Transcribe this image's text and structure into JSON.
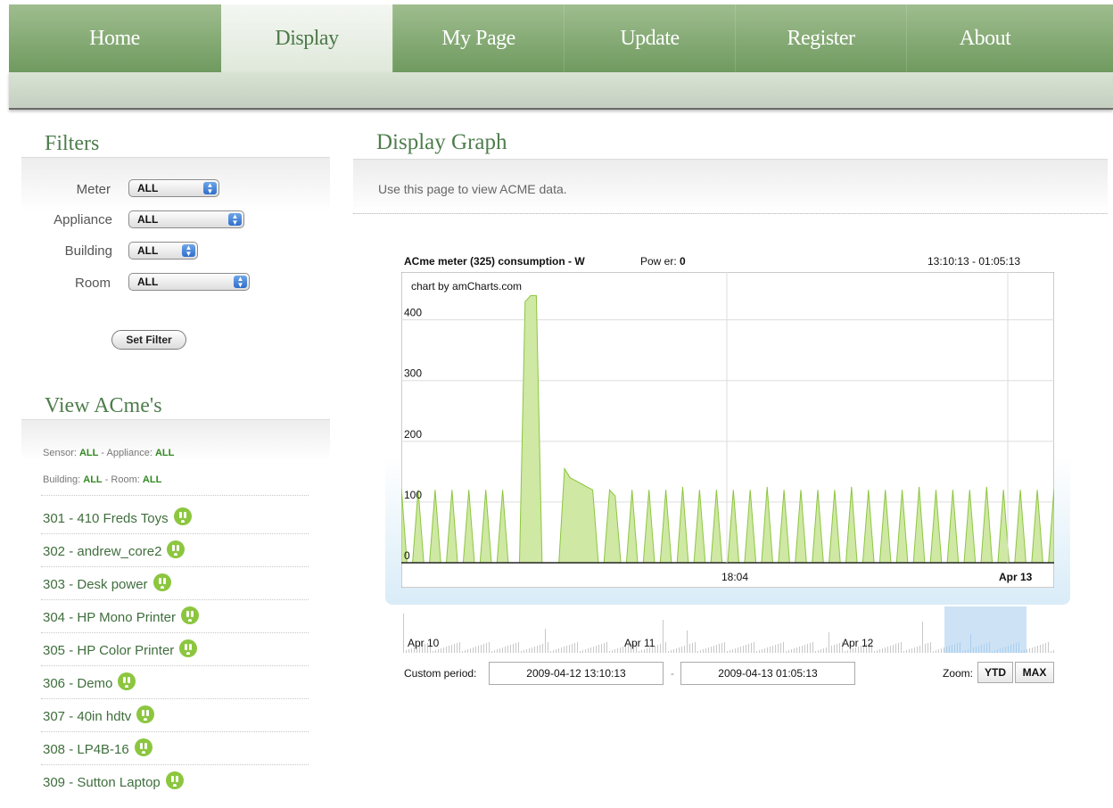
{
  "nav": {
    "items": [
      {
        "label": "Home"
      },
      {
        "label": "Display"
      },
      {
        "label": "My Page"
      },
      {
        "label": "Update"
      },
      {
        "label": "Register"
      },
      {
        "label": "About"
      }
    ],
    "active": "Display"
  },
  "filters": {
    "title": "Filters",
    "meter": {
      "label": "Meter",
      "value": "ALL"
    },
    "appliance": {
      "label": "Appliance",
      "value": "ALL"
    },
    "building": {
      "label": "Building",
      "value": "ALL"
    },
    "room": {
      "label": "Room",
      "value": "ALL"
    },
    "button_label": "Set Filter"
  },
  "view": {
    "title": "View ACme's",
    "sensor_label": "Sensor:",
    "sensor_value": "ALL",
    "appliance_label": " - Appliance:",
    "appliance_value": "ALL",
    "building_label": "Building:",
    "building_value": "ALL",
    "room_label": " - Room:",
    "room_value": "ALL",
    "items": [
      {
        "label": "301 - 410 Freds Toys",
        "icon": "plug-icon"
      },
      {
        "label": "302 - andrew_core2",
        "icon": "plug-icon"
      },
      {
        "label": "303 - Desk power",
        "icon": "plug-icon"
      },
      {
        "label": "304 - HP Mono Printer",
        "icon": "plug-icon"
      },
      {
        "label": "305 - HP Color Printer",
        "icon": "plug-icon"
      },
      {
        "label": "306 - Demo",
        "icon": "plug-icon"
      },
      {
        "label": "307 - 40in hdtv",
        "icon": "plug-icon"
      },
      {
        "label": "308 - LP4B-16",
        "icon": "plug-icon"
      },
      {
        "label": "309 - Sutton Laptop",
        "icon": "plug-icon"
      }
    ]
  },
  "main": {
    "title": "Display Graph",
    "description": "Use this page to view ACME data."
  },
  "chart_header": {
    "title": "ACme meter (325) consumption - W",
    "power_label": "Pow er:",
    "power_value": "0",
    "range": "13:10:13 - 01:05:13",
    "credit": "chart by amCharts.com"
  },
  "chart_data": {
    "type": "area",
    "title": "ACme meter (325) consumption - W",
    "xlabel": "",
    "ylabel": "",
    "ylim": [
      0,
      470
    ],
    "y_ticks": [
      "0",
      "100",
      "200",
      "300",
      "400"
    ],
    "x_tick_labels": [
      "18:04",
      "Apr 13"
    ],
    "grid": true,
    "color": "#8cc63f",
    "series": [
      {
        "values": [
          125,
          0,
          0,
          120,
          0,
          0,
          120,
          0,
          0,
          120,
          0,
          0,
          120,
          0,
          0,
          120,
          0,
          0,
          120,
          0,
          0,
          0,
          430,
          440,
          440,
          0,
          0,
          0,
          0,
          155,
          140,
          135,
          130,
          125,
          120,
          0,
          0,
          120,
          110,
          0,
          0,
          120,
          0,
          0,
          120,
          0,
          0,
          120,
          0,
          0,
          125,
          0,
          0,
          120,
          0,
          0,
          120,
          0,
          0,
          120,
          0,
          0,
          120,
          0,
          0,
          125,
          0,
          0,
          120,
          0,
          0,
          120,
          0,
          0,
          120,
          0,
          0,
          120,
          0,
          0,
          125,
          0,
          0,
          120,
          0,
          0,
          120,
          0,
          0,
          120,
          0,
          0,
          125,
          0,
          0,
          120,
          0,
          0,
          120,
          0,
          0,
          120,
          0,
          0,
          125,
          0,
          0,
          120,
          0,
          0,
          120,
          0,
          0,
          120,
          0,
          0,
          125
        ]
      }
    ]
  },
  "navigator": {
    "labels": [
      "Apr 10",
      "Apr 11",
      "Apr 12"
    ]
  },
  "period": {
    "label": "Custom period:",
    "from": "2009-04-12 13:10:13",
    "separator": "-",
    "to": "2009-04-13 01:05:13",
    "zoom_label": "Zoom:",
    "zoom_buttons": [
      "YTD",
      "MAX"
    ]
  }
}
